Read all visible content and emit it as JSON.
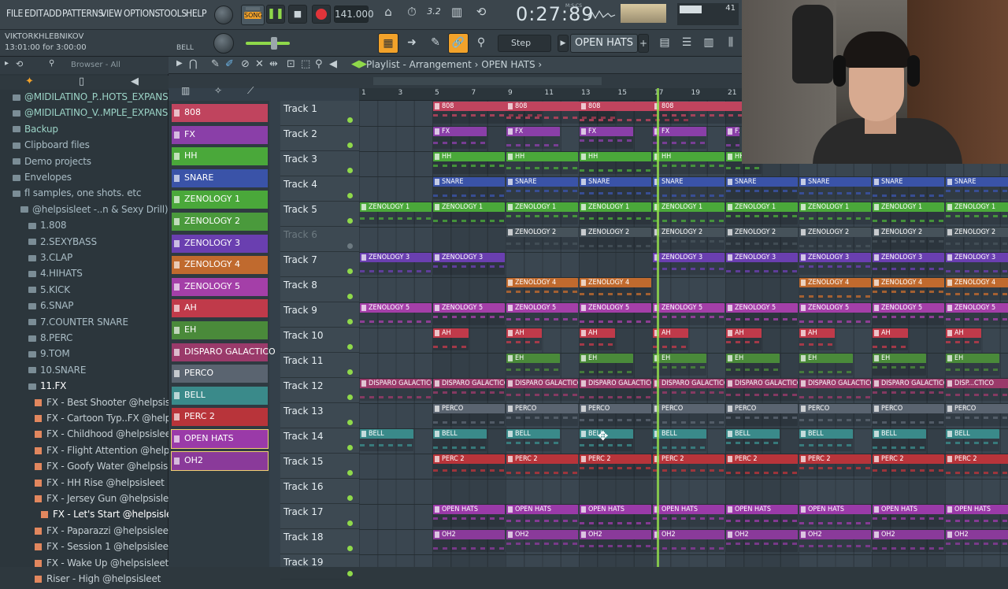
{
  "menu": [
    "FILE",
    "EDIT",
    "ADD",
    "PATTERNS",
    "VIEW",
    "OPTIONS",
    "TOOLS",
    "HELP"
  ],
  "transport": {
    "mode": "SONG",
    "tempo": "141.000",
    "time": "0:27:89",
    "time_unit": "M:S:CS",
    "cpu": "41"
  },
  "hint": {
    "user": "VIKTORKHLEBNIKOV",
    "project_time": "13:01:00 for 3:00:00",
    "selected_channel": "BELL"
  },
  "toolbar2": {
    "snap": "Step",
    "pattern": "OPEN HATS"
  },
  "browser": {
    "title": "Browser - All",
    "items": [
      {
        "label": "@MIDILATINO_P..HOTS_EXPANSION",
        "kind": "hl"
      },
      {
        "label": "@MIDILATINO_V..MPLE_EXPANSION",
        "kind": "hl"
      },
      {
        "label": "Backup",
        "kind": "hl"
      },
      {
        "label": "Clipboard files",
        "kind": "folder"
      },
      {
        "label": "Demo projects",
        "kind": "folder"
      },
      {
        "label": "Envelopes",
        "kind": "folder"
      },
      {
        "label": "fl samples, one shots. etc",
        "kind": "folder"
      },
      {
        "label": "@helpsisleet -..n & Sexy Drill)",
        "kind": "folder"
      },
      {
        "label": "1.808",
        "kind": "folder"
      },
      {
        "label": "2.SEXYBASS",
        "kind": "folder"
      },
      {
        "label": "3.CLAP",
        "kind": "folder"
      },
      {
        "label": "4.HIHATS",
        "kind": "folder"
      },
      {
        "label": "5.KICK",
        "kind": "folder"
      },
      {
        "label": "6.SNAP",
        "kind": "folder"
      },
      {
        "label": "7.COUNTER SNARE",
        "kind": "folder"
      },
      {
        "label": "8.PERC",
        "kind": "folder"
      },
      {
        "label": "9.TOM",
        "kind": "folder"
      },
      {
        "label": "10.SNARE",
        "kind": "folder"
      },
      {
        "label": "11.FX",
        "kind": "folder"
      },
      {
        "label": "FX - Best Shooter @helpsisleet",
        "kind": "file"
      },
      {
        "label": "FX - Cartoon Typ..FX @helpsisleet",
        "kind": "file"
      },
      {
        "label": "FX - Childhood @helpsisleet",
        "kind": "file"
      },
      {
        "label": "FX - Flight Attention @helpsisleet",
        "kind": "file"
      },
      {
        "label": "FX - Goofy Water @helpsisleet",
        "kind": "file"
      },
      {
        "label": "FX - HH Rise @helpsisleet",
        "kind": "file"
      },
      {
        "label": "FX - Jersey Gun @helpsisleet",
        "kind": "file"
      },
      {
        "label": "FX - Let's Start @helpsisleet",
        "kind": "file"
      },
      {
        "label": "FX - Paparazzi @helpsisleet",
        "kind": "file"
      },
      {
        "label": "FX - Session 1 @helpsisleet",
        "kind": "file"
      },
      {
        "label": "FX - Wake Up @helpsisleet",
        "kind": "file"
      },
      {
        "label": "Riser - High @helpsisleet",
        "kind": "file"
      }
    ]
  },
  "playlist": {
    "title": "Playlist - Arrangement",
    "pattern": "OPEN HATS"
  },
  "ruler": [
    "1",
    "3",
    "5",
    "7",
    "9",
    "11",
    "13",
    "15",
    "17",
    "19",
    "21"
  ],
  "patterns": [
    {
      "name": "808",
      "color": "#c0445e"
    },
    {
      "name": "FX",
      "color": "#8a3fa8"
    },
    {
      "name": "HH",
      "color": "#4aa83a"
    },
    {
      "name": "SNARE",
      "color": "#3a53a8"
    },
    {
      "name": "ZENOLOGY 1",
      "color": "#4aa83a"
    },
    {
      "name": "ZENOLOGY 2",
      "color": "#4a9a3c"
    },
    {
      "name": "ZENOLOGY 3",
      "color": "#6a3fb0"
    },
    {
      "name": "ZENOLOGY 4",
      "color": "#c06a2e"
    },
    {
      "name": "ZENOLOGY 5",
      "color": "#a43fa8"
    },
    {
      "name": "AH",
      "color": "#c03a4a"
    },
    {
      "name": "EH",
      "color": "#4a8a3a"
    },
    {
      "name": "DISPARO GALACTICO",
      "color": "#9a3a6a"
    },
    {
      "name": "PERCO",
      "color": "#5a6470"
    },
    {
      "name": "BELL",
      "color": "#3a8a8a"
    },
    {
      "name": "PERC 2",
      "color": "#b8343a"
    },
    {
      "name": "OPEN HATS",
      "color": "#9a3aa8"
    },
    {
      "name": "OH2",
      "color": "#8a3a9a"
    }
  ],
  "tracks": [
    "Track 1",
    "Track 2",
    "Track 3",
    "Track 4",
    "Track 5",
    "Track 6",
    "Track 7",
    "Track 8",
    "Track 9",
    "Track 10",
    "Track 11",
    "Track 12",
    "Track 13",
    "Track 14",
    "Track 15",
    "Track 16",
    "Track 17",
    "Track 18",
    "Track 19"
  ],
  "clips": [
    {
      "t": 0,
      "s": 1,
      "e": 2.5,
      "n": "808",
      "c": "#c0445e"
    },
    {
      "t": 0,
      "s": 2,
      "e": 3.5,
      "n": "808",
      "c": "#c0445e"
    },
    {
      "t": 0,
      "s": 3,
      "e": 4.5,
      "n": "808",
      "c": "#c0445e"
    },
    {
      "t": 0,
      "s": 4,
      "e": 5.5,
      "n": "808",
      "c": "#c0445e"
    },
    {
      "t": 1,
      "s": 1,
      "e": 1.75,
      "n": "FX",
      "c": "#8a3fa8"
    },
    {
      "t": 1,
      "s": 2,
      "e": 2.75,
      "n": "FX",
      "c": "#8a3fa8"
    },
    {
      "t": 1,
      "s": 3,
      "e": 3.75,
      "n": "FX",
      "c": "#8a3fa8"
    },
    {
      "t": 1,
      "s": 4,
      "e": 4.75,
      "n": "FX",
      "c": "#8a3fa8"
    },
    {
      "t": 1,
      "s": 5,
      "e": 5.2,
      "n": "FX",
      "c": "#8a3fa8"
    },
    {
      "t": 2,
      "s": 1,
      "e": 2,
      "n": "HH",
      "c": "#4aa83a"
    },
    {
      "t": 2,
      "s": 2,
      "e": 3,
      "n": "HH",
      "c": "#4aa83a"
    },
    {
      "t": 2,
      "s": 3,
      "e": 4,
      "n": "HH",
      "c": "#4aa83a"
    },
    {
      "t": 2,
      "s": 4,
      "e": 5,
      "n": "HH",
      "c": "#4aa83a"
    },
    {
      "t": 2,
      "s": 5,
      "e": 5.5,
      "n": "HH",
      "c": "#4aa83a"
    },
    {
      "t": 3,
      "s": 1,
      "e": 2,
      "n": "SNARE",
      "c": "#3a53a8"
    },
    {
      "t": 3,
      "s": 2,
      "e": 3,
      "n": "SNARE",
      "c": "#3a53a8"
    },
    {
      "t": 3,
      "s": 3,
      "e": 4,
      "n": "SNARE",
      "c": "#3a53a8"
    },
    {
      "t": 3,
      "s": 4,
      "e": 5,
      "n": "SNARE",
      "c": "#3a53a8"
    },
    {
      "t": 3,
      "s": 5,
      "e": 6,
      "n": "SNARE",
      "c": "#3a53a8"
    },
    {
      "t": 3,
      "s": 6,
      "e": 7,
      "n": "SNARE",
      "c": "#3a53a8"
    },
    {
      "t": 3,
      "s": 7,
      "e": 8,
      "n": "SNARE",
      "c": "#3a53a8"
    },
    {
      "t": 3,
      "s": 8,
      "e": 9,
      "n": "SNARE",
      "c": "#3a53a8"
    },
    {
      "t": 4,
      "s": 0,
      "e": 1,
      "n": "ZENOLOGY 1",
      "c": "#4aa83a"
    },
    {
      "t": 4,
      "s": 1,
      "e": 2,
      "n": "ZENOLOGY 1",
      "c": "#4aa83a"
    },
    {
      "t": 4,
      "s": 2,
      "e": 3,
      "n": "ZENOLOGY 1",
      "c": "#4aa83a"
    },
    {
      "t": 4,
      "s": 3,
      "e": 4,
      "n": "ZENOLOGY 1",
      "c": "#4aa83a"
    },
    {
      "t": 4,
      "s": 4,
      "e": 5,
      "n": "ZENOLOGY 1",
      "c": "#4aa83a"
    },
    {
      "t": 4,
      "s": 5,
      "e": 6,
      "n": "ZENOLOGY 1",
      "c": "#4aa83a"
    },
    {
      "t": 4,
      "s": 6,
      "e": 7,
      "n": "ZENOLOGY 1",
      "c": "#4aa83a"
    },
    {
      "t": 4,
      "s": 7,
      "e": 8,
      "n": "ZENOLOGY 1",
      "c": "#4aa83a"
    },
    {
      "t": 4,
      "s": 8,
      "e": 9,
      "n": "ZENOLOGY 1",
      "c": "#4aa83a"
    },
    {
      "t": 5,
      "s": 2,
      "e": 3,
      "n": "ZENOLOGY 2",
      "c": "#46525a"
    },
    {
      "t": 5,
      "s": 3,
      "e": 4,
      "n": "ZENOLOGY 2",
      "c": "#46525a"
    },
    {
      "t": 5,
      "s": 4,
      "e": 5,
      "n": "ZENOLOGY 2",
      "c": "#46525a"
    },
    {
      "t": 5,
      "s": 5,
      "e": 6,
      "n": "ZENOLOGY 2",
      "c": "#46525a"
    },
    {
      "t": 5,
      "s": 6,
      "e": 7,
      "n": "ZENOLOGY 2",
      "c": "#46525a"
    },
    {
      "t": 5,
      "s": 7,
      "e": 8,
      "n": "ZENOLOGY 2",
      "c": "#46525a"
    },
    {
      "t": 5,
      "s": 8,
      "e": 9,
      "n": "ZENOLOGY 2",
      "c": "#46525a"
    },
    {
      "t": 6,
      "s": 0,
      "e": 1,
      "n": "ZENOLOGY 3",
      "c": "#6a3fb0"
    },
    {
      "t": 6,
      "s": 1,
      "e": 2,
      "n": "ZENOLOGY 3",
      "c": "#6a3fb0"
    },
    {
      "t": 6,
      "s": 4,
      "e": 5,
      "n": "ZENOLOGY 3",
      "c": "#6a3fb0"
    },
    {
      "t": 6,
      "s": 5,
      "e": 6,
      "n": "ZENOLOGY 3",
      "c": "#6a3fb0"
    },
    {
      "t": 6,
      "s": 6,
      "e": 7,
      "n": "ZENOLOGY 3",
      "c": "#6a3fb0"
    },
    {
      "t": 6,
      "s": 7,
      "e": 8,
      "n": "ZENOLOGY 3",
      "c": "#6a3fb0"
    },
    {
      "t": 6,
      "s": 8,
      "e": 9,
      "n": "ZENOLOGY 3",
      "c": "#6a3fb0"
    },
    {
      "t": 7,
      "s": 2,
      "e": 3,
      "n": "ZENOLOGY 4",
      "c": "#c06a2e"
    },
    {
      "t": 7,
      "s": 3,
      "e": 4,
      "n": "ZENOLOGY 4",
      "c": "#c06a2e"
    },
    {
      "t": 7,
      "s": 6,
      "e": 7,
      "n": "ZENOLOGY 4",
      "c": "#c06a2e"
    },
    {
      "t": 7,
      "s": 7,
      "e": 8,
      "n": "ZENOLOGY 4",
      "c": "#c06a2e"
    },
    {
      "t": 7,
      "s": 8,
      "e": 9,
      "n": "ZENOLOGY 4",
      "c": "#c06a2e"
    },
    {
      "t": 8,
      "s": 0,
      "e": 1,
      "n": "ZENOLOGY 5",
      "c": "#a43fa8"
    },
    {
      "t": 8,
      "s": 1,
      "e": 2,
      "n": "ZENOLOGY 5",
      "c": "#a43fa8"
    },
    {
      "t": 8,
      "s": 2,
      "e": 3,
      "n": "ZENOLOGY 5",
      "c": "#a43fa8"
    },
    {
      "t": 8,
      "s": 3,
      "e": 4,
      "n": "ZENOLOGY 5",
      "c": "#a43fa8"
    },
    {
      "t": 8,
      "s": 4,
      "e": 5,
      "n": "ZENOLOGY 5",
      "c": "#a43fa8"
    },
    {
      "t": 8,
      "s": 5,
      "e": 6,
      "n": "ZENOLOGY 5",
      "c": "#a43fa8"
    },
    {
      "t": 8,
      "s": 6,
      "e": 7,
      "n": "ZENOLOGY 5",
      "c": "#a43fa8"
    },
    {
      "t": 8,
      "s": 7,
      "e": 8,
      "n": "ZENOLOGY 5",
      "c": "#a43fa8"
    },
    {
      "t": 8,
      "s": 8,
      "e": 9,
      "n": "ZENOLOGY 5",
      "c": "#a43fa8"
    },
    {
      "t": 9,
      "s": 1,
      "e": 1.5,
      "n": "AH",
      "c": "#c03a4a"
    },
    {
      "t": 9,
      "s": 2,
      "e": 2.5,
      "n": "AH",
      "c": "#c03a4a"
    },
    {
      "t": 9,
      "s": 3,
      "e": 3.5,
      "n": "AH",
      "c": "#c03a4a"
    },
    {
      "t": 9,
      "s": 4,
      "e": 4.5,
      "n": "AH",
      "c": "#c03a4a"
    },
    {
      "t": 9,
      "s": 5,
      "e": 5.5,
      "n": "AH",
      "c": "#c03a4a"
    },
    {
      "t": 9,
      "s": 6,
      "e": 6.5,
      "n": "AH",
      "c": "#c03a4a"
    },
    {
      "t": 9,
      "s": 7,
      "e": 7.5,
      "n": "AH",
      "c": "#c03a4a"
    },
    {
      "t": 9,
      "s": 8,
      "e": 8.5,
      "n": "AH",
      "c": "#c03a4a"
    },
    {
      "t": 10,
      "s": 2,
      "e": 2.75,
      "n": "EH",
      "c": "#4a8a3a"
    },
    {
      "t": 10,
      "s": 3,
      "e": 3.75,
      "n": "EH",
      "c": "#4a8a3a"
    },
    {
      "t": 10,
      "s": 4,
      "e": 4.75,
      "n": "EH",
      "c": "#4a8a3a"
    },
    {
      "t": 10,
      "s": 5,
      "e": 5.75,
      "n": "EH",
      "c": "#4a8a3a"
    },
    {
      "t": 10,
      "s": 6,
      "e": 6.75,
      "n": "EH",
      "c": "#4a8a3a"
    },
    {
      "t": 10,
      "s": 7,
      "e": 7.75,
      "n": "EH",
      "c": "#4a8a3a"
    },
    {
      "t": 10,
      "s": 8,
      "e": 8.75,
      "n": "EH",
      "c": "#4a8a3a"
    },
    {
      "t": 11,
      "s": 0,
      "e": 1,
      "n": "DISPARO GALACTICO",
      "c": "#9a3a6a"
    },
    {
      "t": 11,
      "s": 1,
      "e": 2,
      "n": "DISPARO GALACTICO",
      "c": "#9a3a6a"
    },
    {
      "t": 11,
      "s": 2,
      "e": 3,
      "n": "DISPARO GALACTICO",
      "c": "#9a3a6a"
    },
    {
      "t": 11,
      "s": 3,
      "e": 4,
      "n": "DISPARO GALACTICO",
      "c": "#9a3a6a"
    },
    {
      "t": 11,
      "s": 4,
      "e": 5,
      "n": "DISPARO GALACTICO",
      "c": "#9a3a6a"
    },
    {
      "t": 11,
      "s": 5,
      "e": 6,
      "n": "DISPARO GALACTICO",
      "c": "#9a3a6a"
    },
    {
      "t": 11,
      "s": 6,
      "e": 7,
      "n": "DISPARO GALACTICO",
      "c": "#9a3a6a"
    },
    {
      "t": 11,
      "s": 7,
      "e": 8,
      "n": "DISPARO GALACTICO",
      "c": "#9a3a6a"
    },
    {
      "t": 11,
      "s": 8,
      "e": 9,
      "n": "DISP...CTICO",
      "c": "#9a3a6a"
    },
    {
      "t": 12,
      "s": 1,
      "e": 2,
      "n": "PERCO",
      "c": "#5a6470"
    },
    {
      "t": 12,
      "s": 2,
      "e": 3,
      "n": "PERCO",
      "c": "#5a6470"
    },
    {
      "t": 12,
      "s": 3,
      "e": 4,
      "n": "PERCO",
      "c": "#5a6470"
    },
    {
      "t": 12,
      "s": 4,
      "e": 5,
      "n": "PERCO",
      "c": "#5a6470"
    },
    {
      "t": 12,
      "s": 5,
      "e": 6,
      "n": "PERCO",
      "c": "#5a6470"
    },
    {
      "t": 12,
      "s": 6,
      "e": 7,
      "n": "PERCO",
      "c": "#5a6470"
    },
    {
      "t": 12,
      "s": 7,
      "e": 8,
      "n": "PERCO",
      "c": "#5a6470"
    },
    {
      "t": 12,
      "s": 8,
      "e": 9,
      "n": "PERCO",
      "c": "#5a6470"
    },
    {
      "t": 13,
      "s": 0,
      "e": 0.75,
      "n": "BELL",
      "c": "#3a8a8a"
    },
    {
      "t": 13,
      "s": 1,
      "e": 1.75,
      "n": "BELL",
      "c": "#3a8a8a"
    },
    {
      "t": 13,
      "s": 2,
      "e": 2.75,
      "n": "BELL",
      "c": "#3a8a8a"
    },
    {
      "t": 13,
      "s": 3,
      "e": 3.75,
      "n": "BELL",
      "c": "#3a8a8a"
    },
    {
      "t": 13,
      "s": 4,
      "e": 4.75,
      "n": "BELL",
      "c": "#3a8a8a"
    },
    {
      "t": 13,
      "s": 5,
      "e": 5.75,
      "n": "BELL",
      "c": "#3a8a8a"
    },
    {
      "t": 13,
      "s": 6,
      "e": 6.75,
      "n": "BELL",
      "c": "#3a8a8a"
    },
    {
      "t": 13,
      "s": 7,
      "e": 7.75,
      "n": "BELL",
      "c": "#3a8a8a"
    },
    {
      "t": 13,
      "s": 8,
      "e": 8.75,
      "n": "BELL",
      "c": "#3a8a8a"
    },
    {
      "t": 14,
      "s": 1,
      "e": 2,
      "n": "PERC 2",
      "c": "#b8343a"
    },
    {
      "t": 14,
      "s": 2,
      "e": 3,
      "n": "PERC 2",
      "c": "#b8343a"
    },
    {
      "t": 14,
      "s": 3,
      "e": 4,
      "n": "PERC 2",
      "c": "#b8343a"
    },
    {
      "t": 14,
      "s": 4,
      "e": 5,
      "n": "PERC 2",
      "c": "#b8343a"
    },
    {
      "t": 14,
      "s": 5,
      "e": 6,
      "n": "PERC 2",
      "c": "#b8343a"
    },
    {
      "t": 14,
      "s": 6,
      "e": 7,
      "n": "PERC 2",
      "c": "#b8343a"
    },
    {
      "t": 14,
      "s": 7,
      "e": 8,
      "n": "PERC 2",
      "c": "#b8343a"
    },
    {
      "t": 14,
      "s": 8,
      "e": 9,
      "n": "PERC 2",
      "c": "#b8343a"
    },
    {
      "t": 16,
      "s": 1,
      "e": 2,
      "n": "OPEN HATS",
      "c": "#9a3aa8"
    },
    {
      "t": 16,
      "s": 2,
      "e": 3,
      "n": "OPEN HATS",
      "c": "#9a3aa8"
    },
    {
      "t": 16,
      "s": 3,
      "e": 4,
      "n": "OPEN HATS",
      "c": "#9a3aa8"
    },
    {
      "t": 16,
      "s": 4,
      "e": 5,
      "n": "OPEN HATS",
      "c": "#9a3aa8"
    },
    {
      "t": 16,
      "s": 5,
      "e": 6,
      "n": "OPEN HATS",
      "c": "#9a3aa8"
    },
    {
      "t": 16,
      "s": 6,
      "e": 7,
      "n": "OPEN HATS",
      "c": "#9a3aa8"
    },
    {
      "t": 16,
      "s": 7,
      "e": 8,
      "n": "OPEN HATS",
      "c": "#9a3aa8"
    },
    {
      "t": 16,
      "s": 8,
      "e": 9,
      "n": "OPEN HATS",
      "c": "#9a3aa8"
    },
    {
      "t": 17,
      "s": 1,
      "e": 2,
      "n": "OH2",
      "c": "#8a3a9a"
    },
    {
      "t": 17,
      "s": 2,
      "e": 3,
      "n": "OH2",
      "c": "#8a3a9a"
    },
    {
      "t": 17,
      "s": 3,
      "e": 4,
      "n": "OH2",
      "c": "#8a3a9a"
    },
    {
      "t": 17,
      "s": 4,
      "e": 5,
      "n": "OH2",
      "c": "#8a3a9a"
    },
    {
      "t": 17,
      "s": 5,
      "e": 6,
      "n": "OH2",
      "c": "#8a3a9a"
    },
    {
      "t": 17,
      "s": 6,
      "e": 7,
      "n": "OH2",
      "c": "#8a3a9a"
    },
    {
      "t": 17,
      "s": 7,
      "e": 8,
      "n": "OH2",
      "c": "#8a3a9a"
    },
    {
      "t": 17,
      "s": 8,
      "e": 9,
      "n": "OH2",
      "c": "#8a3a9a"
    }
  ]
}
